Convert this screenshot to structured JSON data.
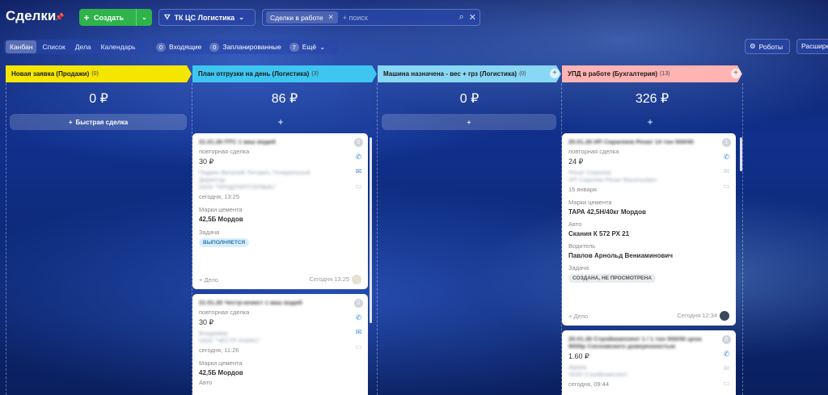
{
  "header": {
    "title": "Сделки",
    "create_label": "Создать",
    "funnel_label": "ТК ЦС Логистика",
    "filter_chip": "Сделки в работе",
    "search_placeholder": "+ поиск"
  },
  "view_tabs": [
    "Канбан",
    "Список",
    "Дела",
    "Календарь"
  ],
  "counters": {
    "incoming_count": "0",
    "incoming_label": "Входящие",
    "planned_count": "0",
    "planned_label": "Запланированные",
    "more_count": "7",
    "more_label": "Ещё"
  },
  "right_buttons": {
    "robots": "Роботы",
    "extensions": "Расшире"
  },
  "columns": [
    {
      "title": "Новая заявка (Продажи)",
      "count": "(0)",
      "sum": "0 ₽",
      "color": "#f5e600",
      "quick_label": "Быстрая сделка"
    },
    {
      "title": "План отгрузки на день (Логистика)",
      "count": "(3)",
      "sum": "86 ₽",
      "color": "#3ec6f0"
    },
    {
      "title": "Машина назначена - вес + грз (Логистика)",
      "count": "(0)",
      "sum": "0 ₽",
      "color": "#88d8f5"
    },
    {
      "title": "УПД в работе (Бухгалтерия)",
      "count": "(13)",
      "sum": "326 ₽",
      "color": "#ffb3b3"
    }
  ],
  "cards": {
    "c1": {
      "title": "21.01.26 ПТС 1 ваш водиб",
      "type": "повторная сделка",
      "amount": "30 ₽",
      "contact": "Подкин Виталий Титович, Генеральный Директор",
      "company": "ООО \"ПРОДТОРГСЕРВИС\"",
      "date": "сегодня, 13:25",
      "cement_label": "Марки цемента",
      "cement_value": "42,5Б Мордов",
      "task_label": "Задача",
      "task_badge": "ВЫПОЛНЯЕТСЯ",
      "add_label": "+ Дело",
      "time": "Сегодня 13:25",
      "count": "0"
    },
    "c2": {
      "title": "21.01.26 Честр-кеикст 1 ваш водиб",
      "type": "повторная сделка",
      "amount": "30 ₽",
      "contact": "Владимир",
      "company": "ООО \"ЧЕСТР-КНИКС\"",
      "date": "сегодня, 11:26",
      "cement_label": "Марки цемента",
      "cement_value": "42,5Б Мордов",
      "auto_label": "Авто",
      "count": "0"
    },
    "c3": {
      "title": "20.01.26 ИП Сириляев Ренат 14 тон 500/40",
      "type": "повторная сделка",
      "amount": "24 ₽",
      "contact": "Ренат Сирилев",
      "company": "ИП Сирилев Ренат Васильевич",
      "date": "15 января",
      "cement_label": "Марки цемента",
      "cement_value": "ТАРА 42,5Н/40кг Мордов",
      "auto_label": "Авто",
      "auto_value": "Скания К 572 РХ 21",
      "driver_label": "Водитель",
      "driver_value": "Павлов Арнольд Вениаминович",
      "task_label": "Задача",
      "task_badge": "СОЗДАНА, НЕ ПРОСМОТРЕНА",
      "add_label": "+ Дело",
      "time": "Сегодня 12:34",
      "count": "1"
    },
    "c4": {
      "title": "20.01.26 Стройкомплект 1 / 1 тон 500/40 цена 9000р Сосновского доверенностью",
      "amount": "1.60 ₽",
      "contact": "Ирина",
      "company": "ООО Стройкомплект",
      "date": "сегодня, 09:44",
      "count": "0"
    }
  }
}
